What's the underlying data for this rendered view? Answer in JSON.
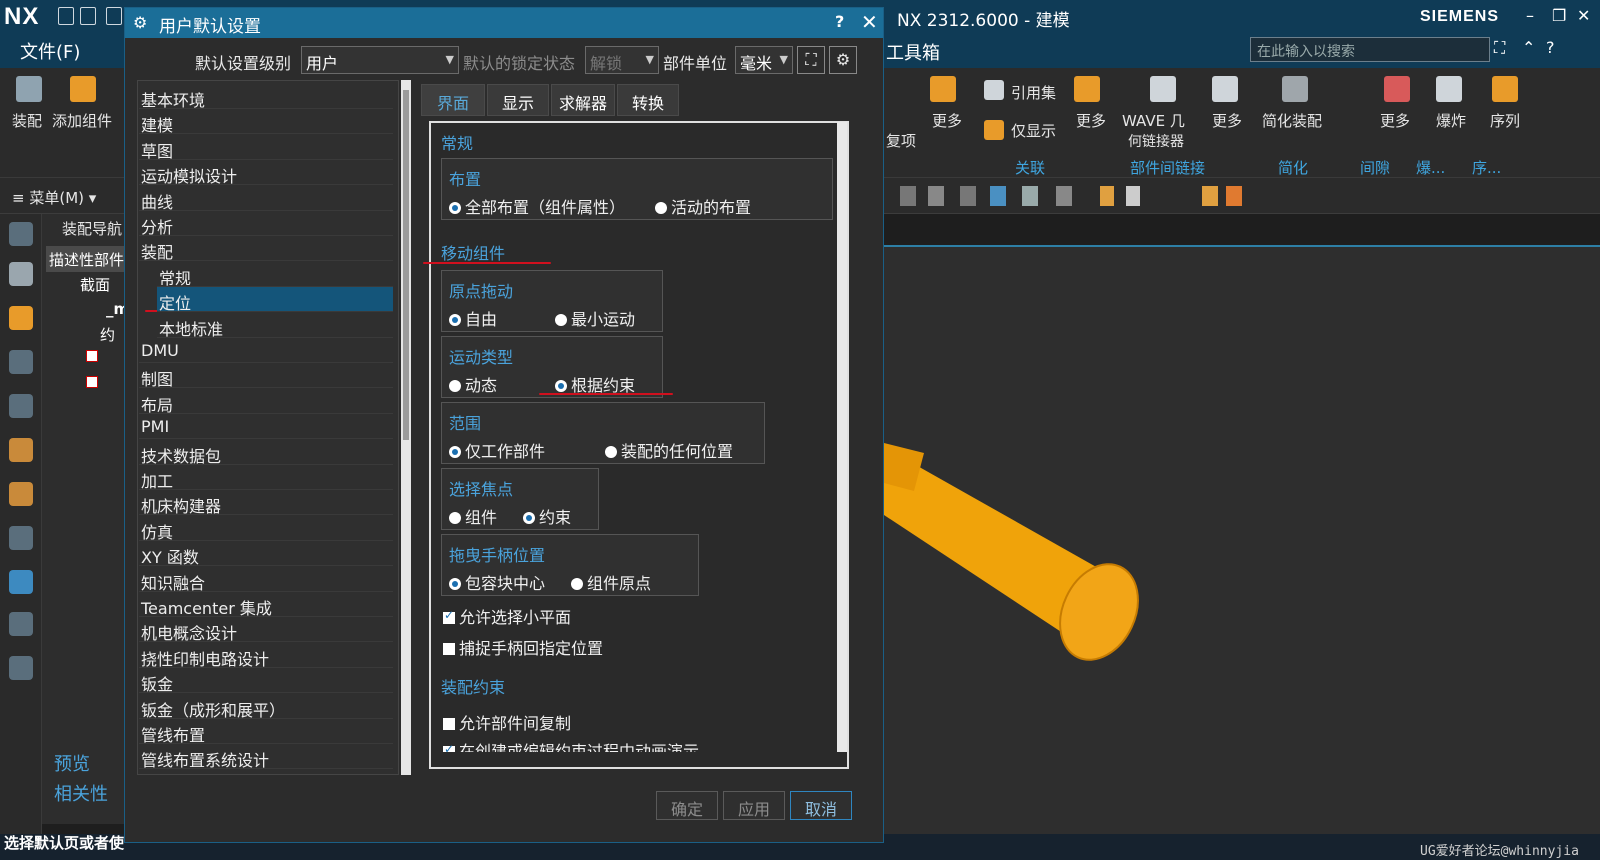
{
  "app": {
    "logo": "NX",
    "title": "NX 2312.6000 - 建模",
    "brand": "SIEMENS",
    "file_menu": "文件(F)",
    "toolbox": "工具箱",
    "search_placeholder": "在此输入以搜索"
  },
  "ribbon": {
    "left_buttons": [
      "装配",
      "添加组件"
    ],
    "items": [
      "复项",
      "更多",
      "引用集",
      "仅显示",
      "更多",
      "WAVE 几",
      "何链接器",
      "更多",
      "简化装配",
      "更多",
      "爆炸",
      "序列"
    ],
    "groups": [
      "关联",
      "部件间链接",
      "简化",
      "间隙",
      "爆...",
      "序..."
    ]
  },
  "row2": {
    "menu": "≡ 菜单(M) ▾"
  },
  "nav": {
    "title": "装配导航",
    "tab": "描述性部件",
    "rows": [
      "截面",
      "_m",
      "约",
      "",
      ""
    ],
    "sections": [
      "预览",
      "相关性"
    ]
  },
  "status": {
    "text": "选择默认页或者使",
    "watermark": "UG爱好者论坛@whinnyjia"
  },
  "dialog": {
    "title": "用户默认设置",
    "help": "?",
    "close": "✕",
    "level_label": "默认设置级别",
    "level_value": "用户",
    "lock_label": "默认的锁定状态",
    "lock_value": "解锁",
    "unit_label": "部件单位",
    "unit_value": "毫米",
    "tree": [
      "基本环境",
      "建模",
      "草图",
      "运动模拟设计",
      "曲线",
      "分析",
      "装配",
      "常规",
      "定位",
      "本地标准",
      "DMU",
      "制图",
      "布局",
      "PMI",
      "技术数据包",
      "加工",
      "机床构建器",
      "仿真",
      "XY 函数",
      "知识融合",
      "Teamcenter 集成",
      "机电概念设计",
      "挠性印制电路设计",
      "钣金",
      "钣金（成形和展平）",
      "管线布置",
      "管线布置系统设计"
    ],
    "tabs": [
      "界面",
      "显示",
      "求解器",
      "转换"
    ],
    "sections": {
      "general": "常规",
      "layout": "布置",
      "layout_opt1": "全部布置（组件属性）",
      "layout_opt2": "活动的布置",
      "move": "移动组件",
      "origin_drag": "原点拖动",
      "origin_opt1": "自由",
      "origin_opt2": "最小运动",
      "motion_type": "运动类型",
      "motion_opt1": "动态",
      "motion_opt2": "根据约束",
      "scope": "范围",
      "scope_opt1": "仅工作部件",
      "scope_opt2": "装配的任何位置",
      "focus": "选择焦点",
      "focus_opt1": "组件",
      "focus_opt2": "约束",
      "handle_pos": "拖曳手柄位置",
      "handle_opt1": "包容块中心",
      "handle_opt2": "组件原点",
      "check1": "允许选择小平面",
      "check2": "捕捉手柄回指定位置",
      "constraints": "装配约束",
      "check3": "允许部件间复制",
      "check4": "在创建或编辑约束过程中动画演示"
    },
    "buttons": {
      "ok": "确定",
      "apply": "应用",
      "cancel": "取消"
    }
  },
  "colors": {
    "accent": "#1b6e98",
    "section_title": "#4aa3dc",
    "annotation": "#d0101e",
    "part": "#f0a30a"
  }
}
